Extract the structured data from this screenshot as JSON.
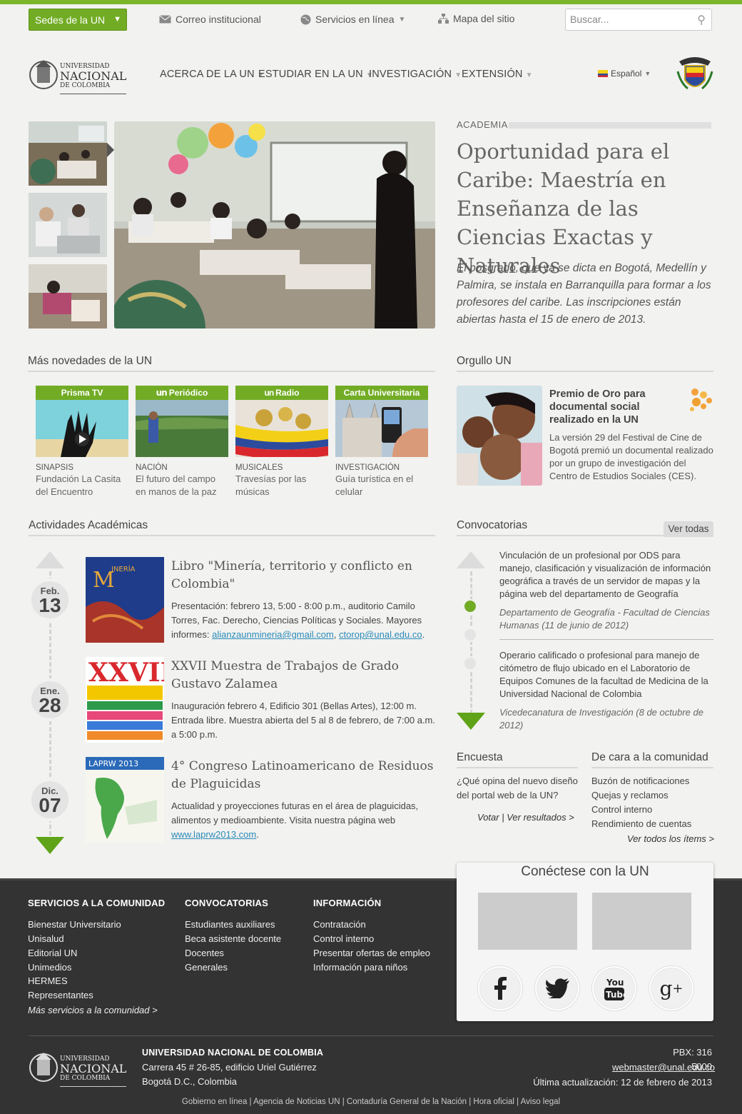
{
  "topbar": {
    "sedes": "Sedes de la UN",
    "correo": "Correo institucional",
    "servicios": "Servicios en línea",
    "mapa": "Mapa del sitio",
    "search_placeholder": "Buscar..."
  },
  "header": {
    "logo_line1": "UNIVERSIDAD",
    "logo_line2": "NACIONAL",
    "logo_line3": "DE COLOMBIA",
    "nav": [
      "ACERCA DE LA UN",
      "ESTUDIAR EN LA UN",
      "INVESTIGACIÓN",
      "EXTENSIÓN"
    ],
    "lang": "Español"
  },
  "hero": {
    "section": "ACADEMIA",
    "title": "Oportunidad para el Caribe: Maestría en Enseñanza de las Ciencias Exactas y Naturales",
    "desc": "El posgrado, que ya se dicta en Bogotá, Medellín y Palmira, se instala en Barranquilla para formar a los profesores del caribe. Las inscripciones están abiertas hasta el 15 de enero de 2013."
  },
  "novedades": {
    "heading": "Más novedades de la UN",
    "cards": [
      {
        "label": "Prisma TV",
        "cat": "SINAPSIS",
        "title": "Fundación La Casita del Encuentro"
      },
      {
        "label": "Periódico",
        "cat": "NACIÓN",
        "title": "El futuro del campo en manos de la paz"
      },
      {
        "label": "Radio",
        "cat": "MUSICALES",
        "title": "Travesías por las músicas"
      },
      {
        "label": "Carta Universitaria",
        "cat": "INVESTIGACIÓN",
        "title": "Guía turística en el celular"
      }
    ]
  },
  "orgullo": {
    "heading": "Orgullo UN",
    "title": "Premio de Oro para documental social realizado en la UN",
    "text": "La versión 29 del Festival de Cine de Bogotá premió un documental realizado por un grupo de investigación del Centro de Estudios Sociales (CES)."
  },
  "actividades": {
    "heading": "Actividades Académicas",
    "items": [
      {
        "month": "Feb.",
        "day": "13",
        "title": "Libro \"Minería, territorio y conflicto en Colombia\"",
        "desc": "Presentación: febrero 13, 5:00 - 8:00 p.m., auditorio Camilo Torres, Fac. Derecho, Ciencias Políticas y Sociales. Mayores informes:",
        "link1": "alianzaunmineria@gmail.com",
        "link2": "ctorop@unal.edu.co"
      },
      {
        "month": "Ene.",
        "day": "28",
        "title": "XXVII Muestra de Trabajos de Grado Gustavo Zalamea",
        "desc": "Inauguración febrero 4, Edificio 301 (Bellas Artes), 12:00 m. Entrada libre. Muestra abierta del 5 al 8 de febrero, de 7:00 a.m. a 5:00 p.m."
      },
      {
        "month": "Dic.",
        "day": "07",
        "title": "4° Congreso Latinoamericano de Residuos de Plaguicidas",
        "desc": "Actualidad y proyecciones futuras en el área  de plaguicidas, alimentos y medioambiente. Visita nuestra página web",
        "link1": "www.laprw2013.com"
      }
    ]
  },
  "convocatorias": {
    "heading": "Convocatorias",
    "ver_todas": "Ver todas",
    "items": [
      {
        "text": "Vinculación de un profesional por ODS para manejo, clasificación y visualización de información geográfica a través de un servidor de mapas y la página web del departamento de Geografía",
        "source": "Departamento de Geografía - Facultad de Ciencias Humanas (11 de junio de 2012)"
      },
      {
        "text": "Operario calificado o profesional para manejo de citómetro de flujo ubicado en el Laboratorio de Equipos Comunes de la facultad de Medicina de la Universidad Nacional de Colombia",
        "source": "Vicedecanatura de Investigación (8 de octubre de 2012)"
      }
    ]
  },
  "encuesta": {
    "heading": "Encuesta",
    "question": "¿Qué opina del nuevo diseño del portal web de la UN?",
    "votar": "Votar",
    "sep": "|",
    "resultados": "Ver resultados >"
  },
  "comunidad": {
    "heading": "De cara a la comunidad",
    "items": [
      "Buzón de notificaciones",
      "Quejas y reclamos",
      "Control interno",
      "Rendimiento de cuentas"
    ],
    "ver": "Ver todos los ítems >"
  },
  "footer": {
    "servicios": {
      "heading": "SERVICIOS A LA COMUNIDAD",
      "items": [
        "Bienestar Universitario",
        "Unisalud",
        "Editorial UN",
        "Unimedios",
        "HERMES",
        "Representantes"
      ],
      "more": "Más servicios a la comunidad >"
    },
    "convocatorias": {
      "heading": "CONVOCATORIAS",
      "items": [
        "Estudiantes auxiliares",
        "Beca asistente docente",
        "Docentes",
        "Generales"
      ]
    },
    "informacion": {
      "heading": "INFORMACIÓN",
      "items": [
        "Contratación",
        "Control interno",
        "Presentar ofertas de empleo",
        "Información para niños"
      ]
    },
    "social_title": "Conéctese con la UN",
    "org": "UNIVERSIDAD NACIONAL DE COLOMBIA",
    "address": "Carrera 45 # 26-85, edificio Uriel Gutiérrez",
    "city": "Bogotá D.C., Colombia",
    "pbx": "PBX: 316 5000",
    "email": "webmaster@unal.edu.co",
    "updated": "Última actualización: 12 de febrero de 2013",
    "bottom_links": "Gobierno en línea | Agencia de Noticias UN | Contaduría General de la Nación | Hora oficial | Aviso legal"
  },
  "colors": {
    "accent": "#72ac25",
    "footer_bg": "#333333"
  }
}
